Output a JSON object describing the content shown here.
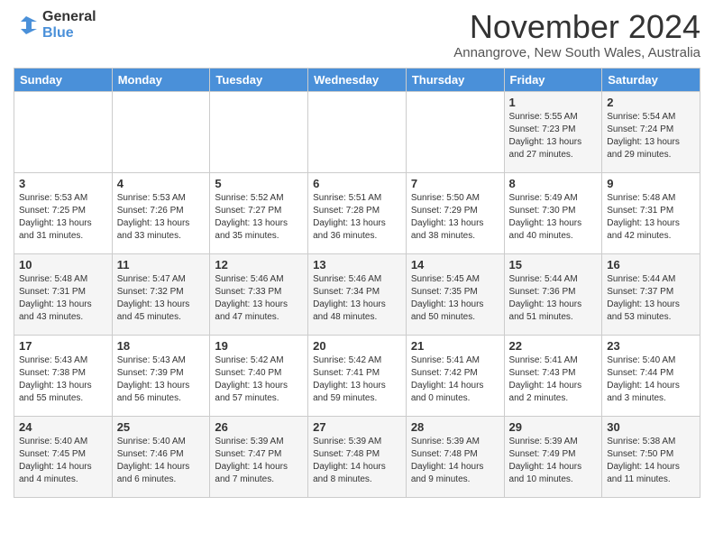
{
  "logo": {
    "general": "General",
    "blue": "Blue"
  },
  "header": {
    "month_title": "November 2024",
    "subtitle": "Annangrove, New South Wales, Australia"
  },
  "weekdays": [
    "Sunday",
    "Monday",
    "Tuesday",
    "Wednesday",
    "Thursday",
    "Friday",
    "Saturday"
  ],
  "weeks": [
    [
      {
        "day": "",
        "info": ""
      },
      {
        "day": "",
        "info": ""
      },
      {
        "day": "",
        "info": ""
      },
      {
        "day": "",
        "info": ""
      },
      {
        "day": "",
        "info": ""
      },
      {
        "day": "1",
        "info": "Sunrise: 5:55 AM\nSunset: 7:23 PM\nDaylight: 13 hours\nand 27 minutes."
      },
      {
        "day": "2",
        "info": "Sunrise: 5:54 AM\nSunset: 7:24 PM\nDaylight: 13 hours\nand 29 minutes."
      }
    ],
    [
      {
        "day": "3",
        "info": "Sunrise: 5:53 AM\nSunset: 7:25 PM\nDaylight: 13 hours\nand 31 minutes."
      },
      {
        "day": "4",
        "info": "Sunrise: 5:53 AM\nSunset: 7:26 PM\nDaylight: 13 hours\nand 33 minutes."
      },
      {
        "day": "5",
        "info": "Sunrise: 5:52 AM\nSunset: 7:27 PM\nDaylight: 13 hours\nand 35 minutes."
      },
      {
        "day": "6",
        "info": "Sunrise: 5:51 AM\nSunset: 7:28 PM\nDaylight: 13 hours\nand 36 minutes."
      },
      {
        "day": "7",
        "info": "Sunrise: 5:50 AM\nSunset: 7:29 PM\nDaylight: 13 hours\nand 38 minutes."
      },
      {
        "day": "8",
        "info": "Sunrise: 5:49 AM\nSunset: 7:30 PM\nDaylight: 13 hours\nand 40 minutes."
      },
      {
        "day": "9",
        "info": "Sunrise: 5:48 AM\nSunset: 7:31 PM\nDaylight: 13 hours\nand 42 minutes."
      }
    ],
    [
      {
        "day": "10",
        "info": "Sunrise: 5:48 AM\nSunset: 7:31 PM\nDaylight: 13 hours\nand 43 minutes."
      },
      {
        "day": "11",
        "info": "Sunrise: 5:47 AM\nSunset: 7:32 PM\nDaylight: 13 hours\nand 45 minutes."
      },
      {
        "day": "12",
        "info": "Sunrise: 5:46 AM\nSunset: 7:33 PM\nDaylight: 13 hours\nand 47 minutes."
      },
      {
        "day": "13",
        "info": "Sunrise: 5:46 AM\nSunset: 7:34 PM\nDaylight: 13 hours\nand 48 minutes."
      },
      {
        "day": "14",
        "info": "Sunrise: 5:45 AM\nSunset: 7:35 PM\nDaylight: 13 hours\nand 50 minutes."
      },
      {
        "day": "15",
        "info": "Sunrise: 5:44 AM\nSunset: 7:36 PM\nDaylight: 13 hours\nand 51 minutes."
      },
      {
        "day": "16",
        "info": "Sunrise: 5:44 AM\nSunset: 7:37 PM\nDaylight: 13 hours\nand 53 minutes."
      }
    ],
    [
      {
        "day": "17",
        "info": "Sunrise: 5:43 AM\nSunset: 7:38 PM\nDaylight: 13 hours\nand 55 minutes."
      },
      {
        "day": "18",
        "info": "Sunrise: 5:43 AM\nSunset: 7:39 PM\nDaylight: 13 hours\nand 56 minutes."
      },
      {
        "day": "19",
        "info": "Sunrise: 5:42 AM\nSunset: 7:40 PM\nDaylight: 13 hours\nand 57 minutes."
      },
      {
        "day": "20",
        "info": "Sunrise: 5:42 AM\nSunset: 7:41 PM\nDaylight: 13 hours\nand 59 minutes."
      },
      {
        "day": "21",
        "info": "Sunrise: 5:41 AM\nSunset: 7:42 PM\nDaylight: 14 hours\nand 0 minutes."
      },
      {
        "day": "22",
        "info": "Sunrise: 5:41 AM\nSunset: 7:43 PM\nDaylight: 14 hours\nand 2 minutes."
      },
      {
        "day": "23",
        "info": "Sunrise: 5:40 AM\nSunset: 7:44 PM\nDaylight: 14 hours\nand 3 minutes."
      }
    ],
    [
      {
        "day": "24",
        "info": "Sunrise: 5:40 AM\nSunset: 7:45 PM\nDaylight: 14 hours\nand 4 minutes."
      },
      {
        "day": "25",
        "info": "Sunrise: 5:40 AM\nSunset: 7:46 PM\nDaylight: 14 hours\nand 6 minutes."
      },
      {
        "day": "26",
        "info": "Sunrise: 5:39 AM\nSunset: 7:47 PM\nDaylight: 14 hours\nand 7 minutes."
      },
      {
        "day": "27",
        "info": "Sunrise: 5:39 AM\nSunset: 7:48 PM\nDaylight: 14 hours\nand 8 minutes."
      },
      {
        "day": "28",
        "info": "Sunrise: 5:39 AM\nSunset: 7:48 PM\nDaylight: 14 hours\nand 9 minutes."
      },
      {
        "day": "29",
        "info": "Sunrise: 5:39 AM\nSunset: 7:49 PM\nDaylight: 14 hours\nand 10 minutes."
      },
      {
        "day": "30",
        "info": "Sunrise: 5:38 AM\nSunset: 7:50 PM\nDaylight: 14 hours\nand 11 minutes."
      }
    ]
  ]
}
